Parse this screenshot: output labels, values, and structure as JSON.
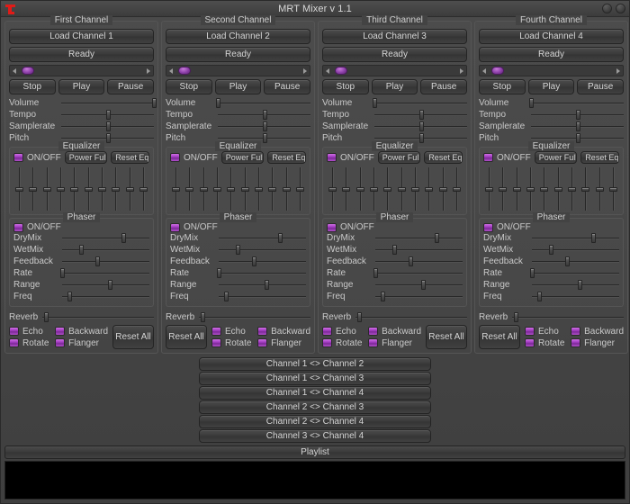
{
  "window": {
    "title": "MRT Mixer v 1.1",
    "icon": "app-logo-icon",
    "buttons": [
      {
        "name": "minimize",
        "label": ""
      },
      {
        "name": "close",
        "label": ""
      }
    ]
  },
  "colors": {
    "accent": "#a13cc0",
    "accent_light": "#d06fe6",
    "window_bg": "#3f3f3f",
    "panel_border": "#555555",
    "text": "#c9c9c9",
    "playlist_bg": "#000000",
    "icon_red": "#e01b18"
  },
  "labels": {
    "on_off": "ON/OFF",
    "equalizer": "Equalizer",
    "phaser": "Phaser",
    "reverb": "Reverb",
    "power_full": "Power Full",
    "reset_eq": "Reset Eq",
    "reset_all": "Reset All",
    "stop": "Stop",
    "play": "Play",
    "pause": "Pause"
  },
  "param_labels": [
    "Volume",
    "Tempo",
    "Samplerate",
    "Pitch"
  ],
  "phaser_labels": [
    "DryMix",
    "WetMix",
    "Feedback",
    "Rate",
    "Range",
    "Freq"
  ],
  "reverb_effects": [
    "Echo",
    "Backward",
    "Rotate",
    "Flanger"
  ],
  "channels": [
    {
      "legend": "First Channel",
      "load_label": "Load Channel 1",
      "status": "Ready",
      "position": 2,
      "params": [
        100,
        50,
        50,
        50
      ],
      "eq_on": true,
      "eq_bands": [
        50,
        50,
        50,
        50,
        50,
        50,
        50,
        50,
        50,
        50
      ],
      "phaser_on": true,
      "phaser": [
        70,
        22,
        40,
        0,
        55,
        8
      ],
      "reverb": 3,
      "reverb_checks": [
        true,
        true,
        true,
        true
      ],
      "reset_side": "right"
    },
    {
      "legend": "Second Channel",
      "load_label": "Load Channel 2",
      "status": "Ready",
      "position": 2,
      "params": [
        0,
        50,
        50,
        50
      ],
      "eq_on": true,
      "eq_bands": [
        50,
        50,
        50,
        50,
        50,
        50,
        50,
        50,
        50,
        50
      ],
      "phaser_on": true,
      "phaser": [
        70,
        22,
        40,
        0,
        55,
        8
      ],
      "reverb": 3,
      "reverb_checks": [
        true,
        true,
        true,
        true
      ],
      "reset_side": "left"
    },
    {
      "legend": "Third Channel",
      "load_label": "Load Channel 3",
      "status": "Ready",
      "position": 2,
      "params": [
        0,
        50,
        50,
        50
      ],
      "eq_on": true,
      "eq_bands": [
        50,
        50,
        50,
        50,
        50,
        50,
        50,
        50,
        50,
        50
      ],
      "phaser_on": true,
      "phaser": [
        70,
        22,
        40,
        0,
        55,
        8
      ],
      "reverb": 3,
      "reverb_checks": [
        true,
        true,
        true,
        true
      ],
      "reset_side": "right"
    },
    {
      "legend": "Fourth Channel",
      "load_label": "Load Channel 4",
      "status": "Ready",
      "position": 2,
      "params": [
        0,
        50,
        50,
        50
      ],
      "eq_on": true,
      "eq_bands": [
        50,
        50,
        50,
        50,
        50,
        50,
        50,
        50,
        50,
        50
      ],
      "phaser_on": true,
      "phaser": [
        70,
        22,
        40,
        0,
        55,
        8
      ],
      "reverb": 3,
      "reverb_checks": [
        true,
        true,
        true,
        true
      ],
      "reset_side": "left"
    }
  ],
  "crosslinks": [
    "Channel 1 <> Channel 2",
    "Channel 1 <> Channel 3",
    "Channel 1 <> Channel 4",
    "Channel 2 <> Channel 3",
    "Channel 2 <> Channel 4",
    "Channel 3 <> Channel 4"
  ],
  "playlist": {
    "header": "Playlist",
    "items": []
  }
}
